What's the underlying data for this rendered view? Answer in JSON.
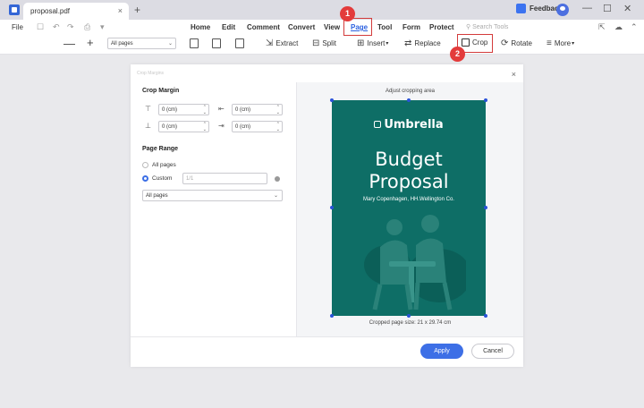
{
  "titlebar": {
    "tab_title": "proposal.pdf",
    "tab_close": "×",
    "new_tab": "+",
    "feedback_label": "Feedback",
    "win_minimize": "—",
    "win_maximize": "☐",
    "win_close": "✕"
  },
  "menubar": {
    "file": "File",
    "quick_actions": [
      "☐",
      "↶",
      "↷",
      "⎙",
      "▾"
    ],
    "items": [
      "Home",
      "Edit",
      "Comment",
      "Convert",
      "View",
      "Page",
      "Tool",
      "Form",
      "Protect"
    ],
    "active": "Page",
    "search_tools": "Search Tools",
    "right_icons": [
      "⇱",
      "☁",
      "⌃"
    ]
  },
  "toolbar": {
    "zoom_out": "—",
    "zoom_in": "+",
    "pages_select": "All pages",
    "extract": "Extract",
    "split": "Split",
    "insert": "Insert",
    "replace": "Replace",
    "crop": "Crop",
    "rotate": "Rotate",
    "more": "More"
  },
  "annotations": {
    "badge_1": "1",
    "badge_2": "2",
    "color": "#d33b3b"
  },
  "dialog": {
    "title": "Crop Margins",
    "close": "×",
    "crop_margin_label": "Crop Margin",
    "margins": {
      "top": "0 (cm)",
      "left": "0 (cm)",
      "bottom": "0 (cm)",
      "right": "0 (cm)"
    },
    "page_range_label": "Page Range",
    "all_pages": "All pages",
    "custom": "Custom",
    "custom_value": "1/1",
    "range_select": "All pages",
    "adjust_label": "Adjust cropping area",
    "cover": {
      "brand": "Umbrella",
      "title_line1": "Budget",
      "title_line2": "Proposal",
      "author": "Mary Copenhagen, HH.Wellington Co.",
      "background": "#0e6e66"
    },
    "crop_size": "Cropped page size: 21 x 29.74 cm",
    "apply": "Apply",
    "cancel": "Cancel"
  }
}
